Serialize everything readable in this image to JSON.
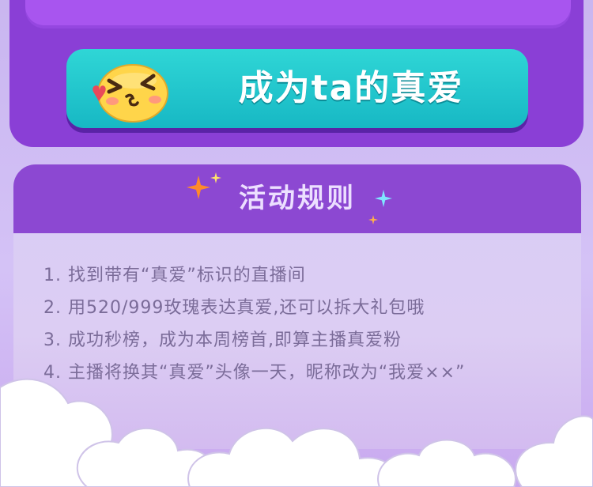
{
  "cta": {
    "label": "成为ta的真爱"
  },
  "rules": {
    "title": "活动规则",
    "items": [
      "1. 找到带有“真爱”标识的直播间",
      "2. 用520/999玫瑰表达真爱,还可以拆大礼包哦",
      "3. 成功秒榜，成为本周榜首,即算主播真爱粉",
      "4. 主播将换其“真爱”头像一天，昵称改为“我爱××”"
    ]
  },
  "colors": {
    "panel": "#8a3fd6",
    "button": "#1fc4cc",
    "header": "#8c48d2",
    "text": "#7b6c99"
  },
  "icons": [
    "kiss-face-icon",
    "sparkle-icon",
    "cloud-decoration"
  ]
}
